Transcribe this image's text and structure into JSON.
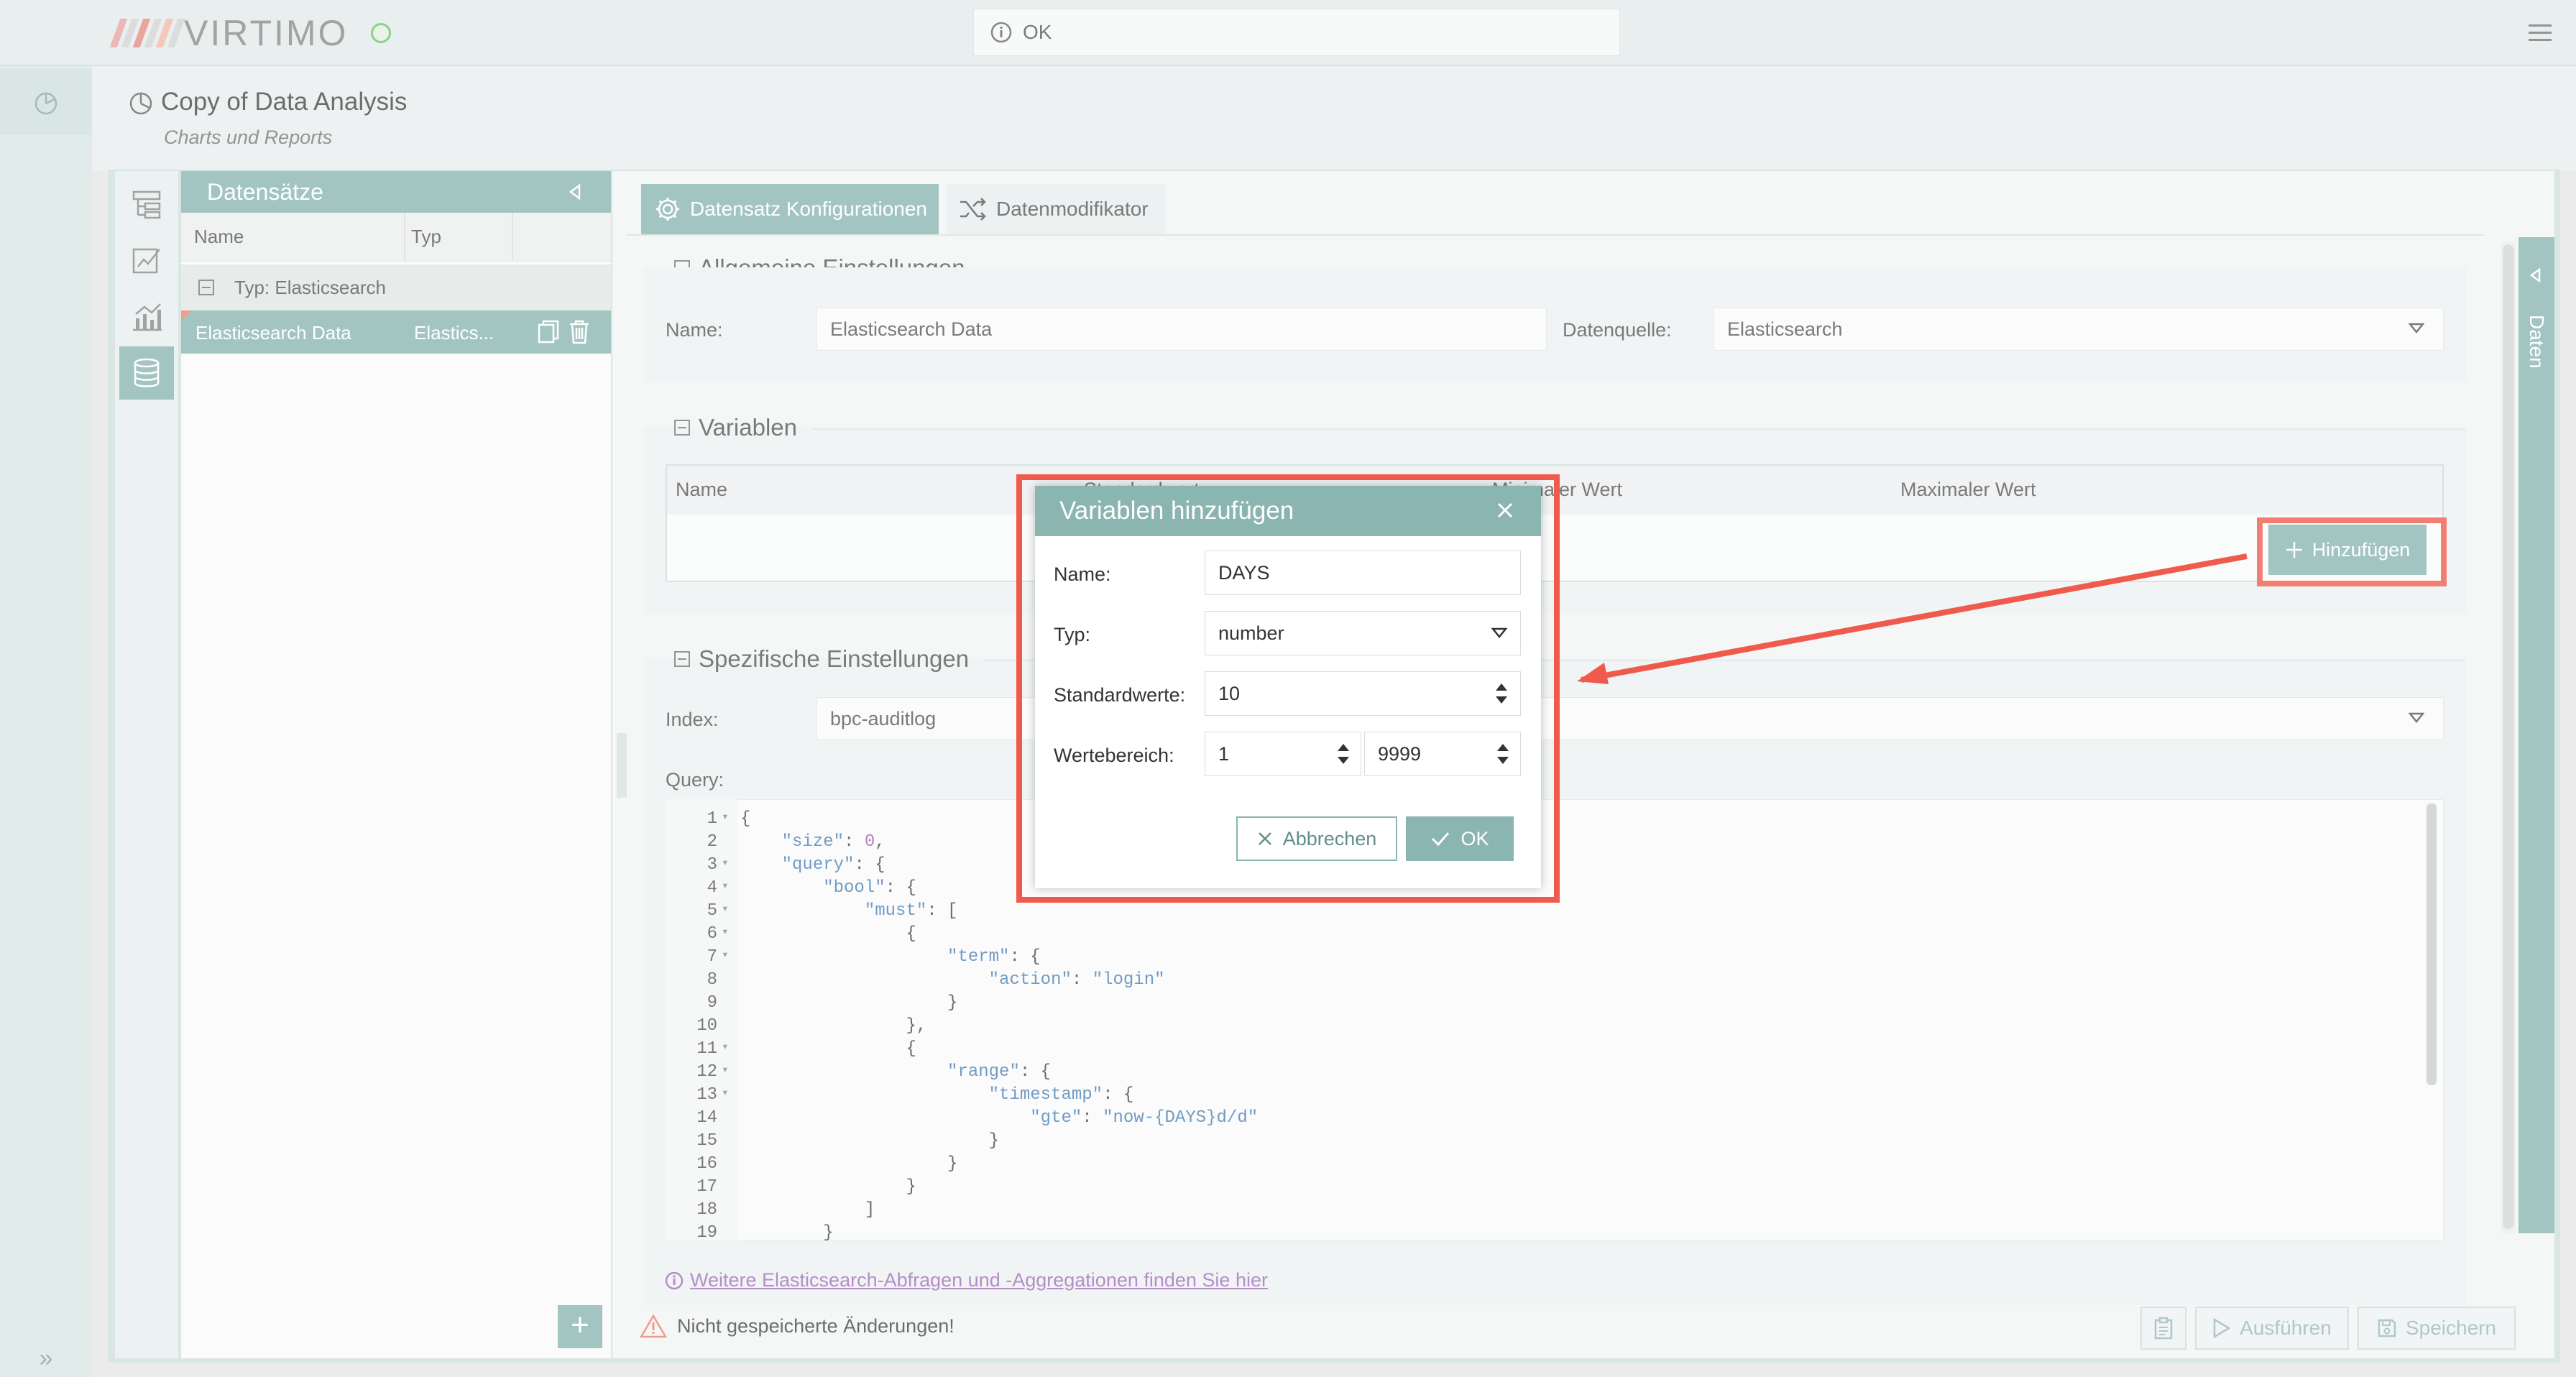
{
  "app": {
    "logo_text": "VIRTIMO",
    "logo_colors": [
      "#e8a3a3",
      "#c6c6c6",
      "#e48b83",
      "#c6c6c6"
    ],
    "status_message": "OK",
    "accent": "#8ab5b0",
    "highlight": "#ef5a4c"
  },
  "page": {
    "title": "Copy of Data Analysis",
    "subtitle": "Charts und Reports"
  },
  "tool_rail": {
    "icons": [
      "tree-icon",
      "edit-chart-icon",
      "chart-icon",
      "database-icon"
    ],
    "active": "database-icon"
  },
  "datasets": {
    "title": "Datensätze",
    "col_name": "Name",
    "col_type": "Typ",
    "group_label": "Typ: Elasticsearch",
    "rows": [
      {
        "name": "Elasticsearch Data",
        "type": "Elastics..."
      }
    ],
    "add_label": "+"
  },
  "tabs": [
    {
      "label": "Datensatz Konfigurationen",
      "active": true
    },
    {
      "label": "Datenmodifikator",
      "active": false
    }
  ],
  "general": {
    "title": "Allgemeine Einstellungen",
    "name_label": "Name:",
    "name_value": "Elasticsearch Data",
    "source_label": "Datenquelle:",
    "source_value": "Elasticsearch"
  },
  "variables": {
    "title": "Variablen",
    "columns": [
      "Name",
      "Standardwert",
      "Minimaler Wert",
      "Maximaler Wert"
    ],
    "add_button": "Hinzufügen"
  },
  "specific": {
    "title": "Spezifische Einstellungen",
    "index_label": "Index:",
    "index_value": "bpc-auditlog",
    "query_label": "Query:"
  },
  "query_lines": [
    "{",
    "    \"size\": 0,",
    "    \"query\": {",
    "        \"bool\": {",
    "            \"must\": [",
    "                {",
    "                    \"term\": {",
    "                        \"action\": \"login\"",
    "                    }",
    "                },",
    "                {",
    "                    \"range\": {",
    "                        \"timestamp\": {",
    "                            \"gte\": \"now-{DAYS}d/d\"",
    "                        }",
    "                    }",
    "                }",
    "            ]",
    "        }"
  ],
  "fold_lines": [
    1,
    3,
    4,
    5,
    6,
    7,
    11,
    12,
    13
  ],
  "info_link": "Weitere Elasticsearch-Abfragen und -Aggregationen finden Sie hier",
  "footer": {
    "unsaved": "Nicht gespeicherte Änderungen!",
    "run": "Ausführen",
    "save": "Speichern"
  },
  "side_tab": "Daten",
  "dialog": {
    "title": "Variablen hinzufügen",
    "name_label": "Name:",
    "name_value": "DAYS",
    "type_label": "Typ:",
    "type_value": "number",
    "default_label": "Standardwerte:",
    "default_value": "10",
    "range_label": "Wertebereich:",
    "range_min": "1",
    "range_max": "9999",
    "cancel": "Abbrechen",
    "ok": "OK"
  }
}
